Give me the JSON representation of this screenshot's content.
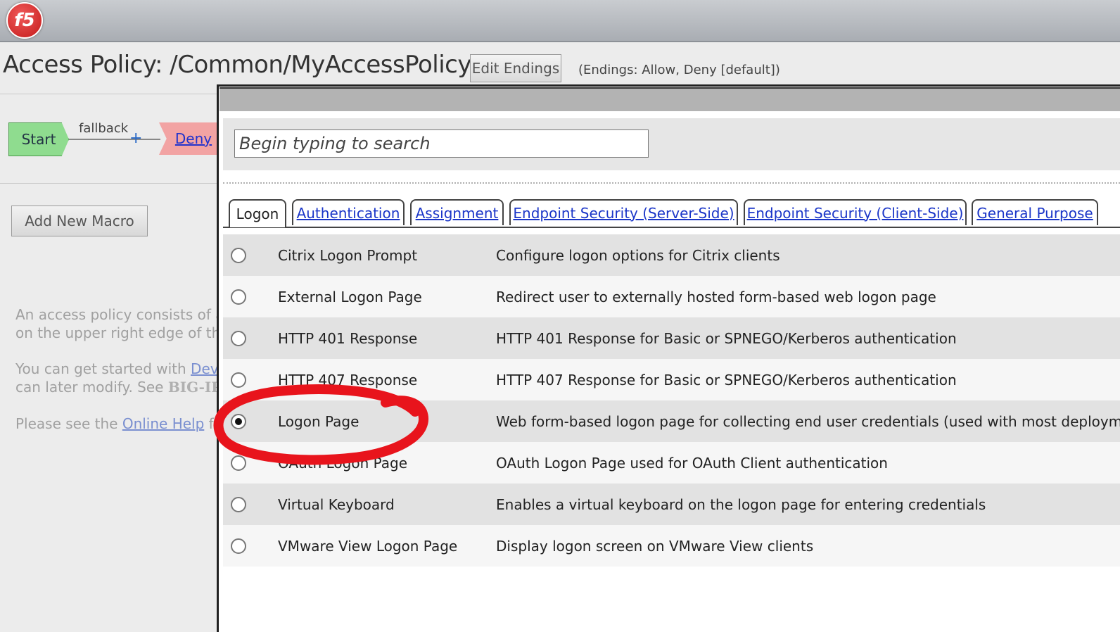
{
  "app": {
    "logo_text": "f5"
  },
  "header": {
    "title": "Access Policy: /Common/MyAccessPolicy",
    "edit_endings_label": "Edit Endings",
    "endings_note": "(Endings: Allow, Deny [default])"
  },
  "flow": {
    "start_label": "Start",
    "branch_label": "fallback",
    "plus": "+",
    "deny_label": "Deny"
  },
  "sidebar": {
    "add_macro_label": "Add New Macro",
    "help1_line1": "An access policy consists of a",
    "help1_line2": "on the upper right edge of the",
    "help2_line1_pre": "You can get started with ",
    "help2_line1_link": "Devi",
    "help2_line2_pre": "can later modify. See ",
    "help2_line2_bold": "BIG-IP",
    "help3_pre": "Please see the ",
    "help3_link": "Online Help",
    "help3_post": " fo"
  },
  "dialog": {
    "search_placeholder": "Begin typing to search",
    "tabs": [
      {
        "label": "Logon",
        "active": true
      },
      {
        "label": "Authentication"
      },
      {
        "label": "Assignment"
      },
      {
        "label": "Endpoint Security (Server-Side)"
      },
      {
        "label": "Endpoint Security (Client-Side)"
      },
      {
        "label": "General Purpose"
      }
    ],
    "items": [
      {
        "name": "Citrix Logon Prompt",
        "desc": "Configure logon options for Citrix clients",
        "selected": false
      },
      {
        "name": "External Logon Page",
        "desc": "Redirect user to externally hosted form-based web logon page",
        "selected": false
      },
      {
        "name": "HTTP 401 Response",
        "desc": "HTTP 401 Response for Basic or SPNEGO/Kerberos authentication",
        "selected": false
      },
      {
        "name": "HTTP 407 Response",
        "desc": "HTTP 407 Response for Basic or SPNEGO/Kerberos authentication",
        "selected": false
      },
      {
        "name": "Logon Page",
        "desc": "Web form-based logon page for collecting end user credentials (used with most deploymer",
        "selected": true
      },
      {
        "name": "OAuth Logon Page",
        "desc": "OAuth Logon Page used for OAuth Client authentication",
        "selected": false
      },
      {
        "name": "Virtual Keyboard",
        "desc": "Enables a virtual keyboard on the logon page for entering credentials",
        "selected": false
      },
      {
        "name": "VMware View Logon Page",
        "desc": "Display logon screen on VMware View clients",
        "selected": false
      }
    ]
  },
  "colors": {
    "annotation": "#e8141c",
    "link": "#1a35c8",
    "start_node": "#8fdc8f",
    "deny_node": "#f2a3a3"
  }
}
